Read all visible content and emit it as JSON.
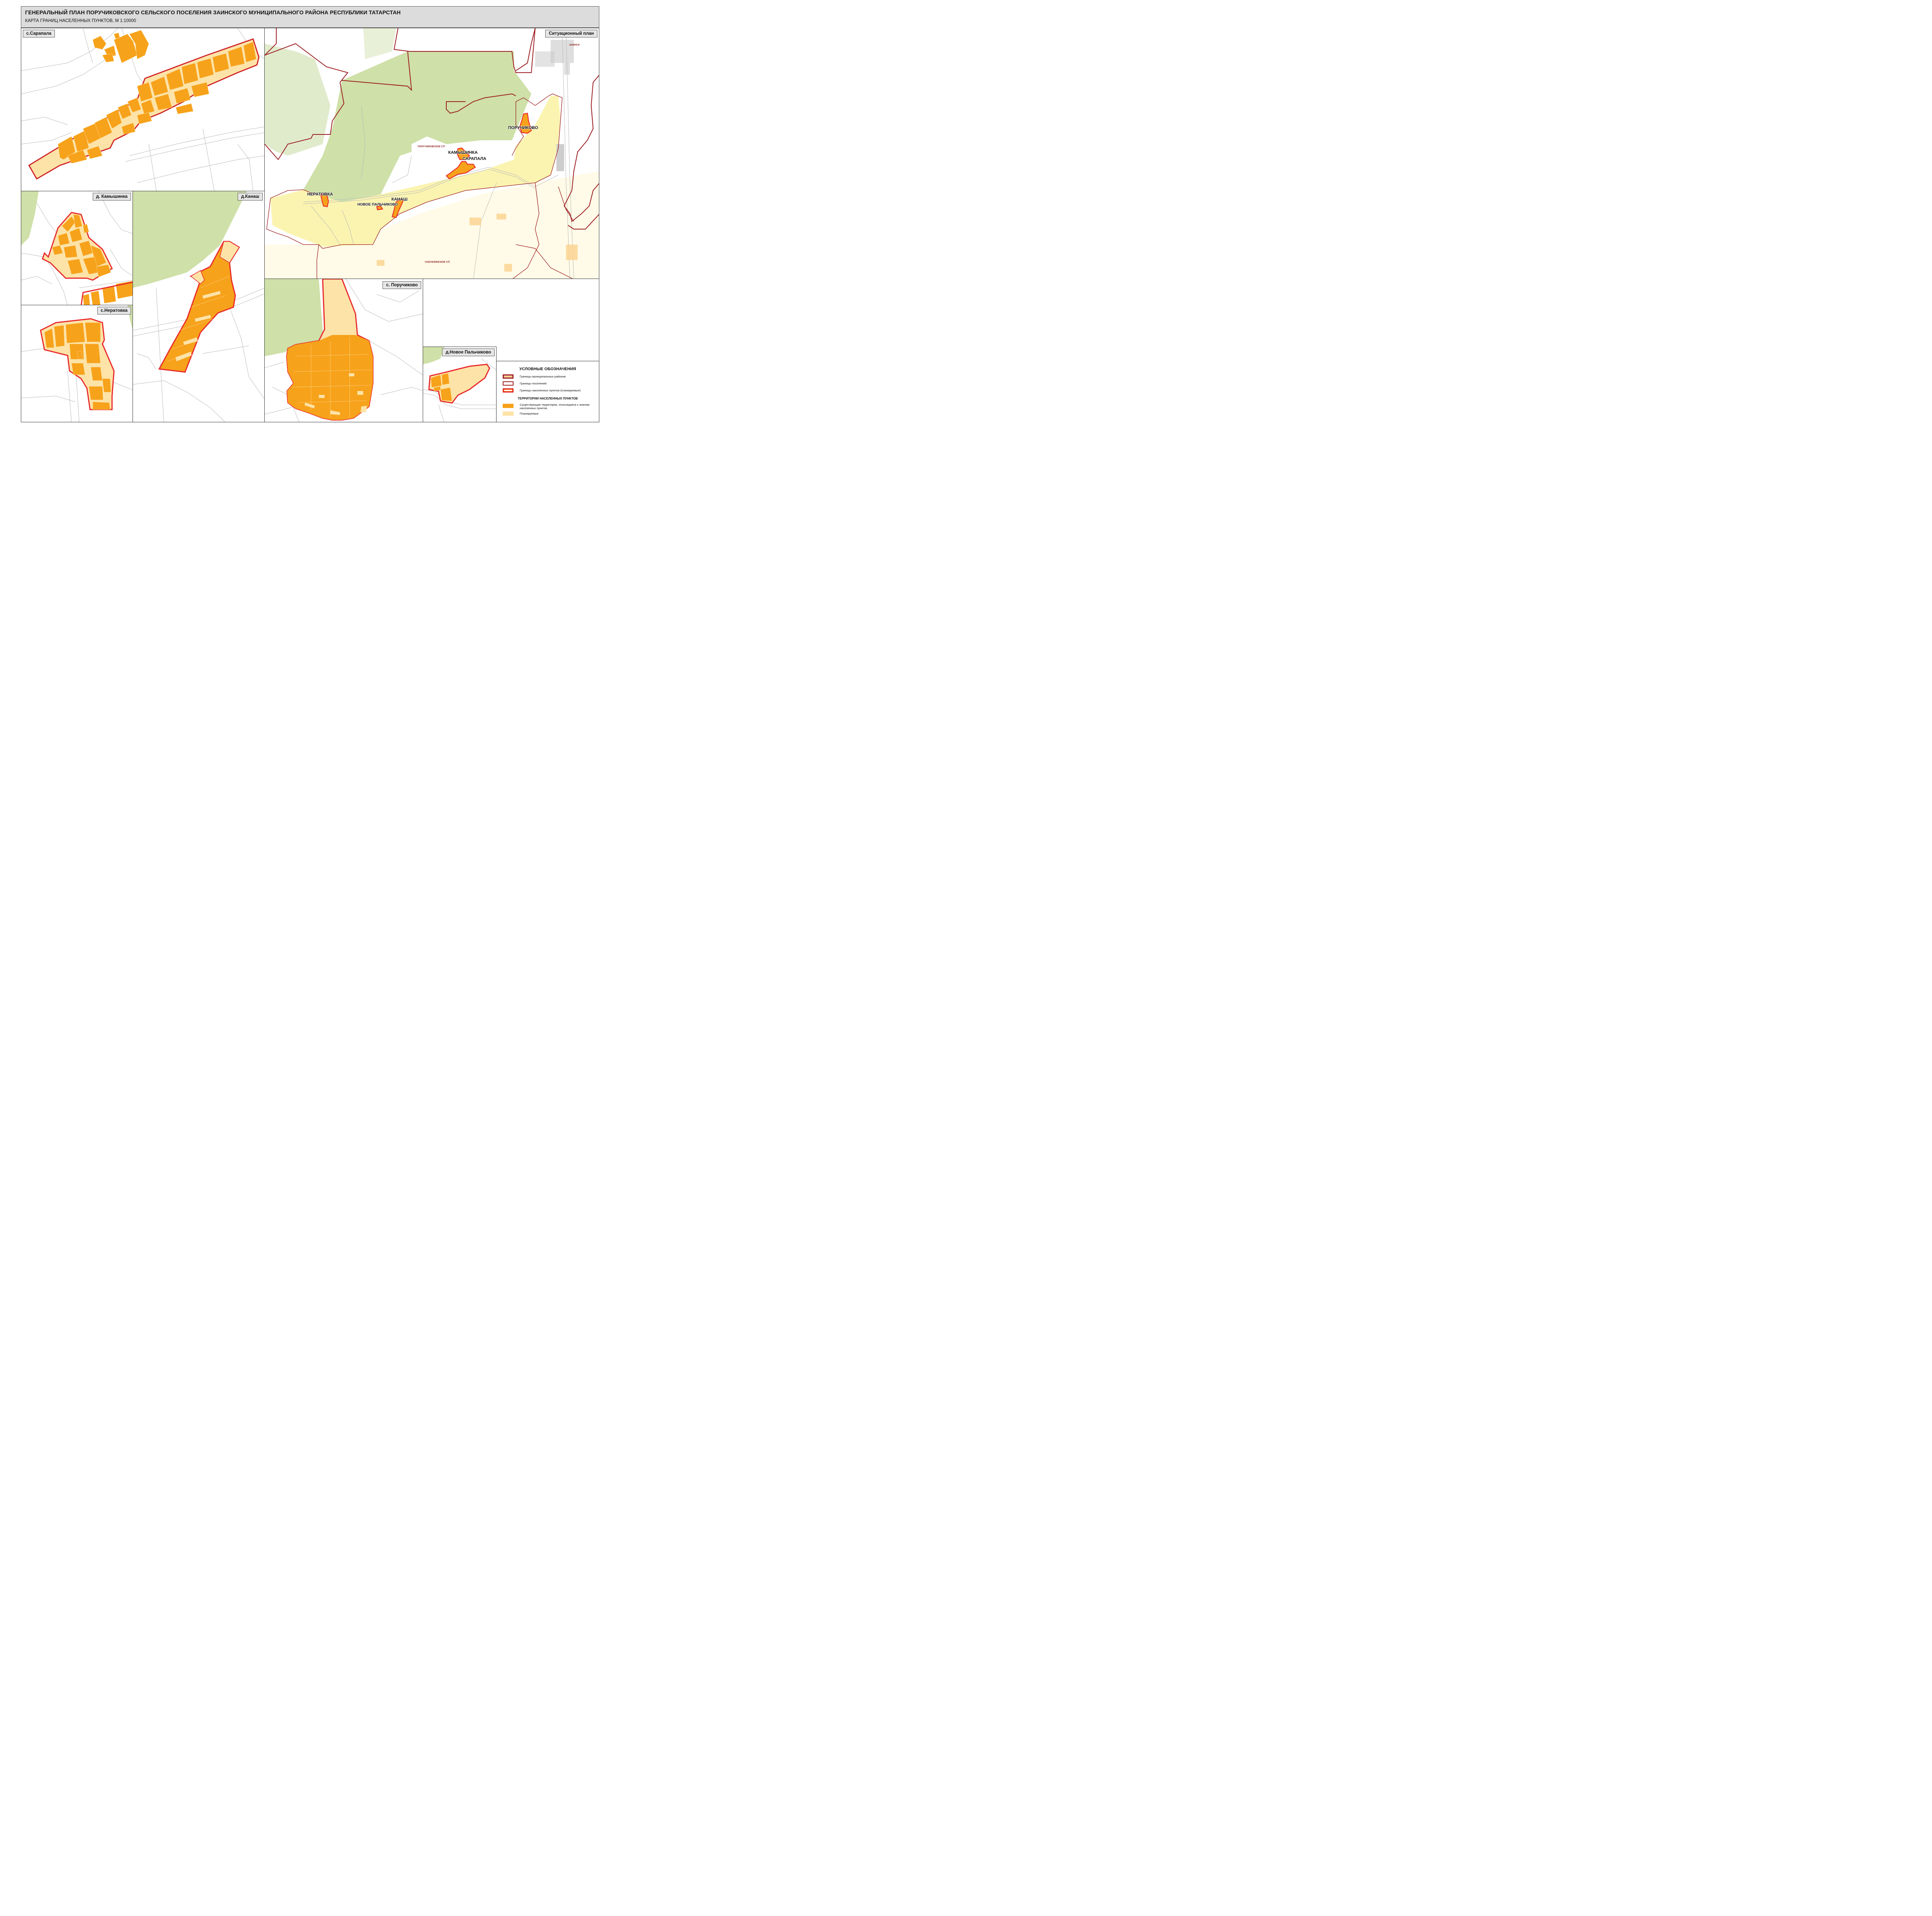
{
  "header": {
    "title": "ГЕНЕРАЛЬНЫЙ ПЛАН ПОРУЧИКОВСКОГО СЕЛЬСКОГО ПОСЕЛЕНИЯ ЗАИНСКОГО МУНИЦИПАЛЬНОГО РАЙОНА РЕСПУБЛИКИ ТАТАРСТАН",
    "subtitle": "КАРТА ГРАНИЦ НАСЕЛЕННЫХ ПУНКТОВ, М 1:10000"
  },
  "panels": {
    "sarapala": "с.Сарапала",
    "kamyshinka": "д. Камышинка",
    "kanash": "д.Канаш",
    "neratovka": "с.Нератовка",
    "poruchikovo": "с. Поручиково",
    "novoe_palchikovo": "д.Новое Пальчиково",
    "situation": "Ситуационный план"
  },
  "situation_labels": {
    "zainsk": "ЗАИНСК",
    "poruchikovo": "ПОРУЧИКОВО",
    "kamyshinka": "КАМЫШИНКА",
    "sarapala": "САРАПАЛА",
    "neratovka": "НЕРАТОВКА",
    "kanash": "КАНАШ",
    "novoe_palchikovo": "НОВОЕ ПАЛЬЧИКОВО",
    "poruchikovskoe_sp": "ПОРУЧИКОВСКОЕ СП",
    "chubuklinskoe_sp": "ЧУБУКЛИНСКОЕ СП"
  },
  "legend": {
    "title": "УСЛОВНЫЕ ОБОЗНАЧЕНИЯ",
    "items": [
      "Границы муниципальных районов",
      "Границы поселений",
      "Границы населенных пунктов (планируемые)"
    ],
    "section_title": "ТЕРРИТОРИИ НАСЕЛЕННЫХ ПУНКТОВ",
    "existing": "Существующие территории, относящиеся к землям населенных пунктов",
    "planned": "Планируемые"
  },
  "colors": {
    "existing": "#f7a21b",
    "planned": "#fde3a7",
    "boundary_settlement_np": "#e8292b",
    "boundary_municipal": "#9b1b1f",
    "forest": "#cfe0a8",
    "settlement_area": "#fbf4b0",
    "roads": "#b9b9b9"
  },
  "map_icons": [
    "settlement-polygon",
    "forest-area",
    "road-line"
  ]
}
